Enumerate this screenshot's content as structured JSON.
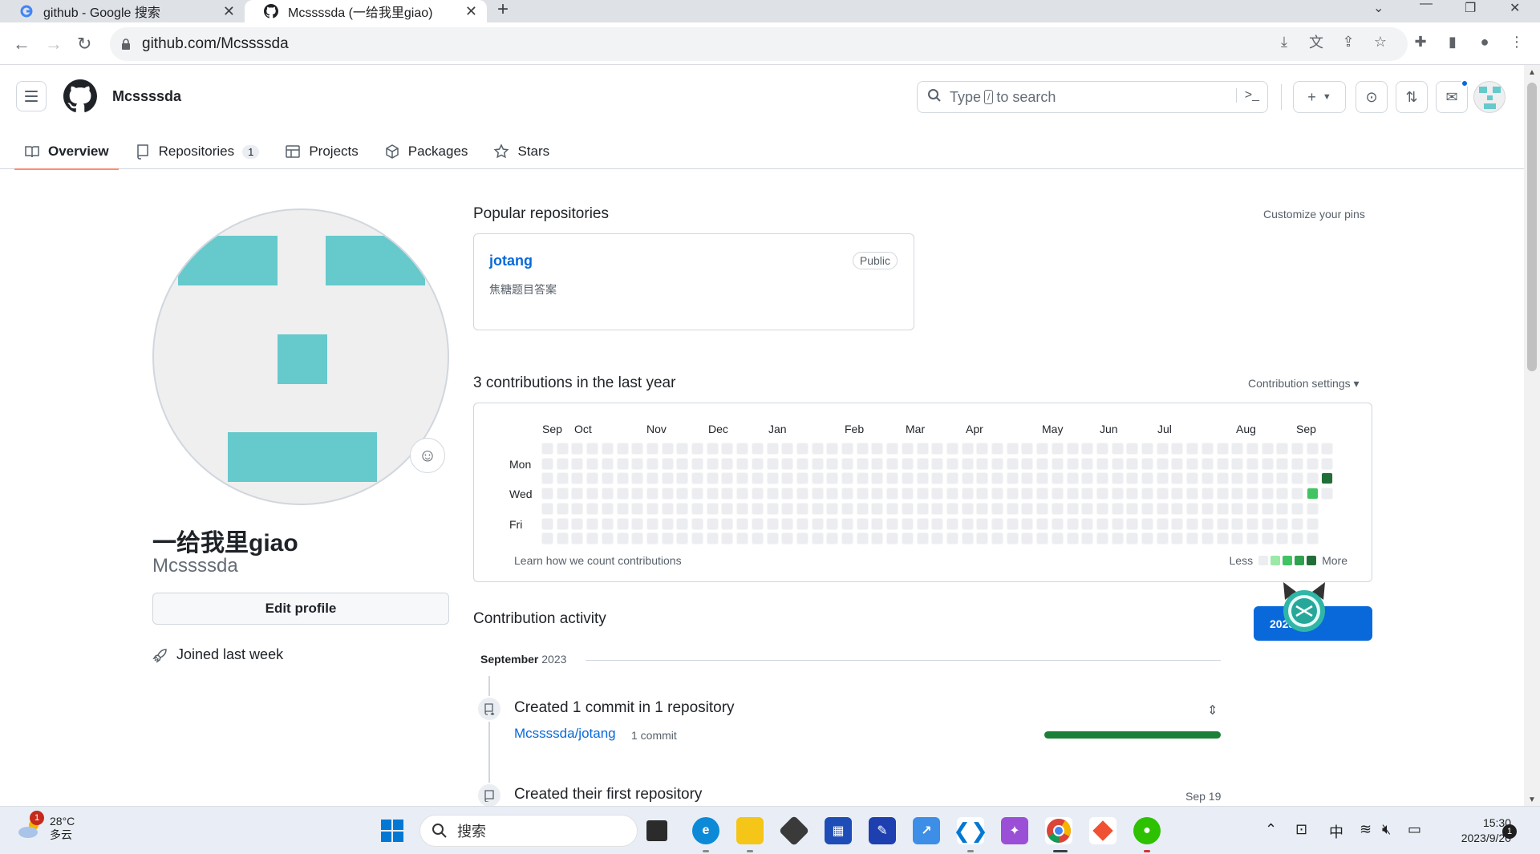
{
  "browser": {
    "tabs": [
      {
        "title": "github - Google 搜索",
        "close": "✕"
      },
      {
        "title": "Mcssssda (一给我里giao)",
        "close": "✕"
      }
    ],
    "new_tab": "+",
    "url": "github.com/Mcssssda"
  },
  "header": {
    "username": "Mcssssda",
    "search_before": "Type",
    "search_key": "/",
    "search_after": "to search",
    "create_label": "+"
  },
  "tabs": [
    {
      "label": "Overview"
    },
    {
      "label": "Repositories",
      "count": "1"
    },
    {
      "label": "Projects"
    },
    {
      "label": "Packages"
    },
    {
      "label": "Stars"
    }
  ],
  "profile": {
    "full_name": "一给我里giao",
    "login": "Mcssssda",
    "edit_button": "Edit profile",
    "joined": "Joined last week"
  },
  "popular": {
    "title": "Popular repositories",
    "customize": "Customize your pins",
    "repo": {
      "name": "jotang",
      "visibility": "Public",
      "description": "焦糖题目答案"
    }
  },
  "contributions": {
    "title": "3 contributions in the last year",
    "settings": "Contribution settings ▾",
    "months": [
      "Sep",
      "Oct",
      "Nov",
      "Dec",
      "Jan",
      "Feb",
      "Mar",
      "Apr",
      "May",
      "Jun",
      "Jul",
      "Aug",
      "Sep"
    ],
    "days": [
      "Mon",
      "Wed",
      "Fri"
    ],
    "learn": "Learn how we count contributions",
    "less": "Less",
    "more": "More",
    "levels": [
      "#ebedf0",
      "#9be9a8",
      "#40c463",
      "#30a14e",
      "#216e39"
    ],
    "active_cells": [
      {
        "week": 52,
        "day": 2,
        "level": 4
      },
      {
        "week": 51,
        "day": 3,
        "level": 2
      }
    ]
  },
  "activity": {
    "title": "Contribution activity",
    "year_button": "2023",
    "month": "September",
    "year": "2023",
    "commit_title": "Created 1 commit in 1 repository",
    "commit_repo": "Mcssssda/jotang",
    "commit_count": "1 commit",
    "repo_title": "Created their first repository",
    "repo_date": "Sep 19"
  },
  "taskbar": {
    "weather_temp": "28°C",
    "weather_desc": "多云",
    "weather_badge": "1",
    "search": "搜索",
    "ime": "中",
    "time": "15:30",
    "date": "2023/9/20",
    "notif": "1"
  }
}
